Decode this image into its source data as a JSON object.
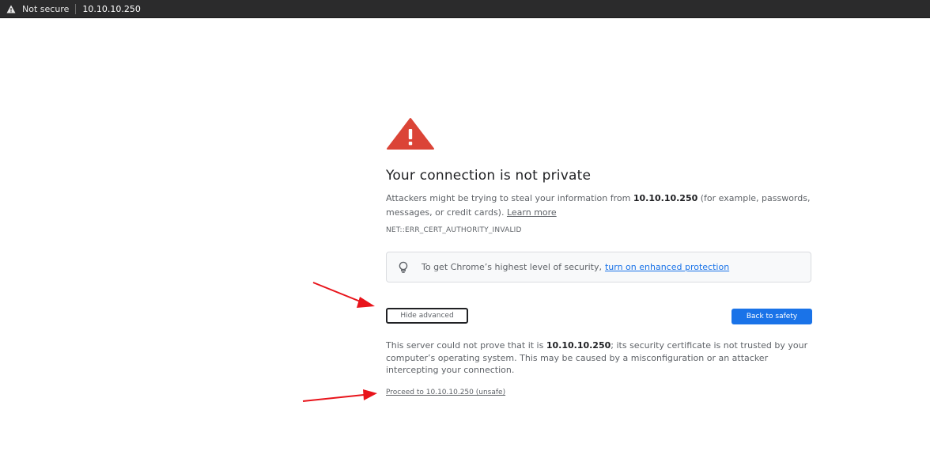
{
  "browser": {
    "security_label": "Not secure",
    "url": "10.10.10.250",
    "security_icon": "warning-triangle-icon"
  },
  "interstitial": {
    "icon": "red-warning-triangle-icon",
    "heading": "Your connection is not private",
    "intro_prefix": "Attackers might be trying to steal your information from ",
    "intro_host": "10.10.10.250",
    "intro_suffix": " (for example, passwords, messages, or credit cards). ",
    "learn_more": "Learn more",
    "error_code": "NET::ERR_CERT_AUTHORITY_INVALID",
    "enhanced_prefix": "To get Chrome’s highest level of security, ",
    "enhanced_link": "turn on enhanced protection",
    "enhanced_icon": "lightbulb-icon",
    "hide_advanced": "Hide advanced",
    "back_to_safety": "Back to safety",
    "advanced_prefix": "This server could not prove that it is ",
    "advanced_host": "10.10.10.250",
    "advanced_suffix": "; its security certificate is not trusted by your computer’s operating system. This may be caused by a misconfiguration or an attacker intercepting your connection.",
    "proceed": "Proceed to 10.10.10.250 (unsafe)"
  },
  "colors": {
    "warning_red": "#db4437",
    "button_blue": "#1a73e8",
    "annotation_arrow": "#e8141b"
  }
}
